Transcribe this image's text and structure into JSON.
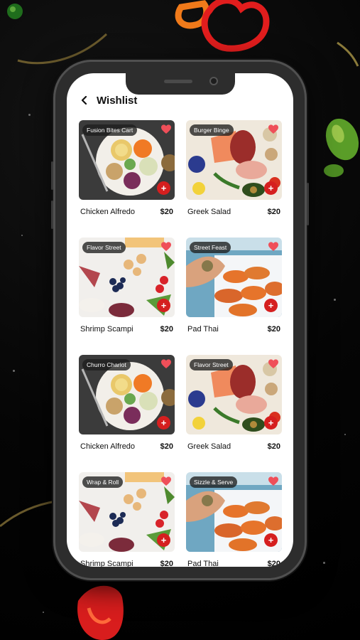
{
  "header": {
    "title": "Wishlist"
  },
  "colors": {
    "accent": "#d51f1f",
    "heart": "#ef4f59",
    "tag_bg": "#1e1e1e"
  },
  "items": [
    {
      "vendor": "Fusion Bites Cart",
      "name": "Chicken Alfredo",
      "price": "$20",
      "image": "bowl"
    },
    {
      "vendor": "Burger Binge",
      "name": "Greek Salad",
      "price": "$20",
      "image": "spread"
    },
    {
      "vendor": "Flavor Street",
      "name": "Shrimp Scampi",
      "price": "$20",
      "image": "fruit"
    },
    {
      "vendor": "Street Feast",
      "name": "Pad Thai",
      "price": "$20",
      "image": "sweet-potato"
    },
    {
      "vendor": "Churro Chariot",
      "name": "Chicken Alfredo",
      "price": "$20",
      "image": "bowl"
    },
    {
      "vendor": "Flavor Street",
      "name": "Greek Salad",
      "price": "$20",
      "image": "spread"
    },
    {
      "vendor": "Wrap & Roll",
      "name": "Shrimp Scampi",
      "price": "$20",
      "image": "fruit"
    },
    {
      "vendor": "Sizzle & Serve",
      "name": "Pad Thai",
      "price": "$20",
      "image": "sweet-potato"
    }
  ]
}
